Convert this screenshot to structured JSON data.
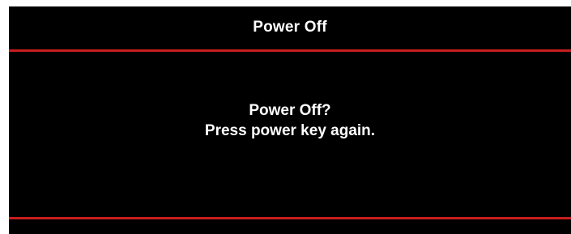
{
  "dialog": {
    "title": "Power Off",
    "message_line1": "Power Off?",
    "message_line2": "Press power key again."
  },
  "colors": {
    "background": "#000000",
    "text": "#ffffff",
    "accent_rule": "#c81e1e"
  }
}
